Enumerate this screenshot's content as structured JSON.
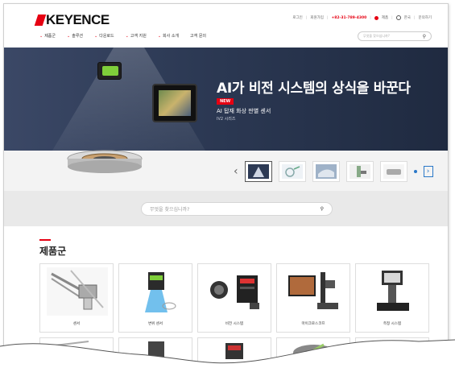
{
  "header": {
    "logo": "KEYENCE",
    "util_links": [
      "로그인",
      "회원가입",
      "+82-31-789-4300",
      "제품",
      "한국",
      "문의하기"
    ],
    "nav": [
      {
        "label": "제품군",
        "caret": true
      },
      {
        "label": "솔루션",
        "caret": true
      },
      {
        "label": "다운로드",
        "caret": true
      },
      {
        "label": "고객 지원",
        "caret": true
      },
      {
        "label": "회사 소개",
        "caret": true
      },
      {
        "label": "고객 문의",
        "caret": false
      }
    ],
    "search_placeholder": "무엇을 찾으십니까?"
  },
  "hero": {
    "title": "AI가 비전 시스템의 상식을 바꾼다",
    "badge": "NEW",
    "subtitle": "AI 탑재 화상 판별 센서",
    "series": "IV2 시리즈"
  },
  "carousel": {
    "prev_icon": "chevron-left-icon",
    "next_icon": "chevron-right-icon",
    "thumbs": 5,
    "active_index": 0
  },
  "search": {
    "placeholder": "무엇을 찾으십니까?"
  },
  "products": {
    "title": "제품군",
    "items": [
      "센서",
      "변위 센서",
      "비전 시스템",
      "마이크로스코프",
      "측정 시스템"
    ]
  },
  "colors": {
    "brand_red": "#e60012",
    "hero_bg": "#2d3a55",
    "accent_blue": "#2a78c8"
  }
}
